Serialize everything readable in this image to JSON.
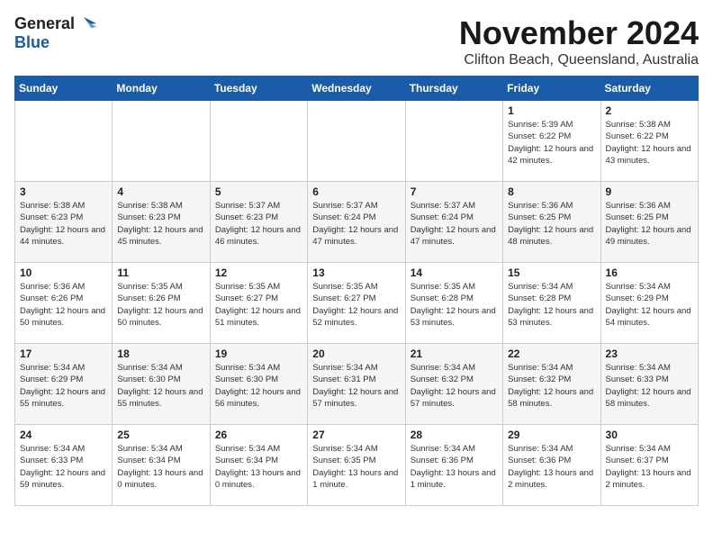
{
  "logo": {
    "line1": "General",
    "line2": "Blue"
  },
  "title": "November 2024",
  "subtitle": "Clifton Beach, Queensland, Australia",
  "weekdays": [
    "Sunday",
    "Monday",
    "Tuesday",
    "Wednesday",
    "Thursday",
    "Friday",
    "Saturday"
  ],
  "weeks": [
    [
      {
        "day": null
      },
      {
        "day": null
      },
      {
        "day": null
      },
      {
        "day": null
      },
      {
        "day": null
      },
      {
        "day": 1,
        "sunrise": "5:39 AM",
        "sunset": "6:22 PM",
        "daylight": "12 hours and 42 minutes."
      },
      {
        "day": 2,
        "sunrise": "5:38 AM",
        "sunset": "6:22 PM",
        "daylight": "12 hours and 43 minutes."
      }
    ],
    [
      {
        "day": 3,
        "sunrise": "5:38 AM",
        "sunset": "6:23 PM",
        "daylight": "12 hours and 44 minutes."
      },
      {
        "day": 4,
        "sunrise": "5:38 AM",
        "sunset": "6:23 PM",
        "daylight": "12 hours and 45 minutes."
      },
      {
        "day": 5,
        "sunrise": "5:37 AM",
        "sunset": "6:23 PM",
        "daylight": "12 hours and 46 minutes."
      },
      {
        "day": 6,
        "sunrise": "5:37 AM",
        "sunset": "6:24 PM",
        "daylight": "12 hours and 47 minutes."
      },
      {
        "day": 7,
        "sunrise": "5:37 AM",
        "sunset": "6:24 PM",
        "daylight": "12 hours and 47 minutes."
      },
      {
        "day": 8,
        "sunrise": "5:36 AM",
        "sunset": "6:25 PM",
        "daylight": "12 hours and 48 minutes."
      },
      {
        "day": 9,
        "sunrise": "5:36 AM",
        "sunset": "6:25 PM",
        "daylight": "12 hours and 49 minutes."
      }
    ],
    [
      {
        "day": 10,
        "sunrise": "5:36 AM",
        "sunset": "6:26 PM",
        "daylight": "12 hours and 50 minutes."
      },
      {
        "day": 11,
        "sunrise": "5:35 AM",
        "sunset": "6:26 PM",
        "daylight": "12 hours and 50 minutes."
      },
      {
        "day": 12,
        "sunrise": "5:35 AM",
        "sunset": "6:27 PM",
        "daylight": "12 hours and 51 minutes."
      },
      {
        "day": 13,
        "sunrise": "5:35 AM",
        "sunset": "6:27 PM",
        "daylight": "12 hours and 52 minutes."
      },
      {
        "day": 14,
        "sunrise": "5:35 AM",
        "sunset": "6:28 PM",
        "daylight": "12 hours and 53 minutes."
      },
      {
        "day": 15,
        "sunrise": "5:34 AM",
        "sunset": "6:28 PM",
        "daylight": "12 hours and 53 minutes."
      },
      {
        "day": 16,
        "sunrise": "5:34 AM",
        "sunset": "6:29 PM",
        "daylight": "12 hours and 54 minutes."
      }
    ],
    [
      {
        "day": 17,
        "sunrise": "5:34 AM",
        "sunset": "6:29 PM",
        "daylight": "12 hours and 55 minutes."
      },
      {
        "day": 18,
        "sunrise": "5:34 AM",
        "sunset": "6:30 PM",
        "daylight": "12 hours and 55 minutes."
      },
      {
        "day": 19,
        "sunrise": "5:34 AM",
        "sunset": "6:30 PM",
        "daylight": "12 hours and 56 minutes."
      },
      {
        "day": 20,
        "sunrise": "5:34 AM",
        "sunset": "6:31 PM",
        "daylight": "12 hours and 57 minutes."
      },
      {
        "day": 21,
        "sunrise": "5:34 AM",
        "sunset": "6:32 PM",
        "daylight": "12 hours and 57 minutes."
      },
      {
        "day": 22,
        "sunrise": "5:34 AM",
        "sunset": "6:32 PM",
        "daylight": "12 hours and 58 minutes."
      },
      {
        "day": 23,
        "sunrise": "5:34 AM",
        "sunset": "6:33 PM",
        "daylight": "12 hours and 58 minutes."
      }
    ],
    [
      {
        "day": 24,
        "sunrise": "5:34 AM",
        "sunset": "6:33 PM",
        "daylight": "12 hours and 59 minutes."
      },
      {
        "day": 25,
        "sunrise": "5:34 AM",
        "sunset": "6:34 PM",
        "daylight": "13 hours and 0 minutes."
      },
      {
        "day": 26,
        "sunrise": "5:34 AM",
        "sunset": "6:34 PM",
        "daylight": "13 hours and 0 minutes."
      },
      {
        "day": 27,
        "sunrise": "5:34 AM",
        "sunset": "6:35 PM",
        "daylight": "13 hours and 1 minute."
      },
      {
        "day": 28,
        "sunrise": "5:34 AM",
        "sunset": "6:36 PM",
        "daylight": "13 hours and 1 minute."
      },
      {
        "day": 29,
        "sunrise": "5:34 AM",
        "sunset": "6:36 PM",
        "daylight": "13 hours and 2 minutes."
      },
      {
        "day": 30,
        "sunrise": "5:34 AM",
        "sunset": "6:37 PM",
        "daylight": "13 hours and 2 minutes."
      }
    ]
  ]
}
